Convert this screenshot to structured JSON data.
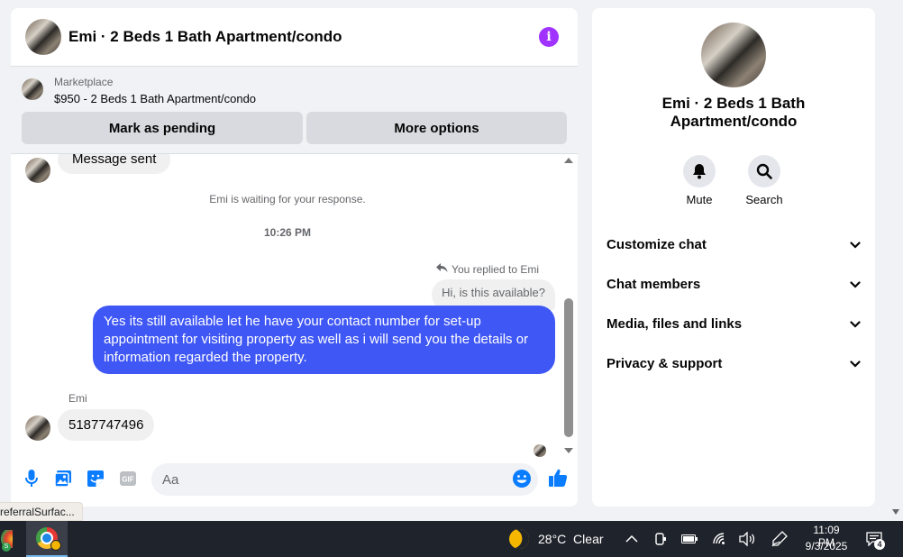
{
  "chat": {
    "title": "Emi · 2 Beds 1 Bath Apartment/condo",
    "marketplace": {
      "label": "Marketplace",
      "listing": "$950 - 2 Beds 1 Bath Apartment/condo",
      "mark_pending": "Mark as pending",
      "more_options": "More options"
    },
    "messages": {
      "previous_partial": "Message sent",
      "waiting": "Emi is waiting for your response.",
      "timestamp": "10:26 PM",
      "replied_label": "You replied to Emi",
      "quoted": "Hi, is this available?",
      "sent": "Yes its still available let he have your contact number for set-up appointment for visiting property as well as i will send you the details or information regarded the property.",
      "sender_name": "Emi",
      "received": "5187747496"
    },
    "composer": {
      "placeholder": "Aa",
      "icons": [
        "microphone-icon",
        "photo-icon",
        "sticker-icon",
        "gif-icon",
        "emoji-icon",
        "thumbs-up-icon"
      ],
      "gif_label": "GIF"
    }
  },
  "info_panel": {
    "name": "Emi · 2 Beds 1 Bath Apartment/condo",
    "actions": [
      {
        "label": "Mute",
        "icon": "bell-icon"
      },
      {
        "label": "Search",
        "icon": "search-icon"
      }
    ],
    "sections": [
      {
        "label": "Customize chat"
      },
      {
        "label": "Chat members"
      },
      {
        "label": "Media, files and links"
      },
      {
        "label": "Privacy & support"
      }
    ]
  },
  "status_tooltip": "referralSurfac...",
  "taskbar": {
    "app1_badge": "S",
    "weather": "28°C  Clear",
    "time": "11:09 PM",
    "date": "9/3/2025",
    "notification_count": "4"
  },
  "colors": {
    "accent_blue": "#3f57f5",
    "info_purple": "#a033ff",
    "like_blue": "#0a7cff",
    "panel_bg": "#f0f2f5",
    "taskbar_bg": "#1f232b"
  }
}
